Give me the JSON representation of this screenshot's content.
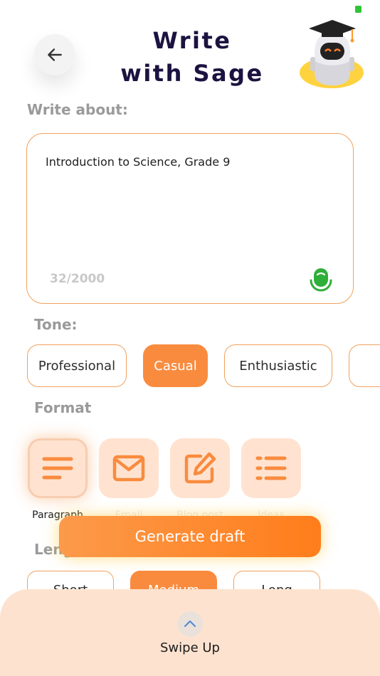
{
  "header": {
    "title_line1": "Write",
    "title_line2": "with Sage",
    "back_icon": "arrow-left-icon",
    "mascot": "robot-graduate-mascot"
  },
  "topic": {
    "label": "Write about:",
    "value": "Introduction to Science, Grade 9",
    "char_count": "32/2000",
    "mic_icon": "microphone-icon"
  },
  "tone": {
    "label": "Tone:",
    "options": [
      "Professional",
      "Casual",
      "Enthusiastic"
    ],
    "selected": "Casual"
  },
  "format": {
    "label": "Format",
    "options": [
      {
        "label": "Paragraph",
        "icon": "paragraph-icon"
      },
      {
        "label": "Email",
        "icon": "mail-icon"
      },
      {
        "label": "Blog post",
        "icon": "edit-icon"
      },
      {
        "label": "Ideas",
        "icon": "list-icon"
      }
    ],
    "selected": "Paragraph"
  },
  "length": {
    "label": "Length",
    "options": [
      "Short",
      "Medium",
      "Long"
    ],
    "selected": "Medium"
  },
  "generate_button": "Generate draft",
  "sheet": {
    "swipe_label": "Swipe Up",
    "swipe_icon": "chevron-up-icon"
  },
  "colors": {
    "accent": "#f98b3f",
    "accent_light": "#ffe3d0",
    "title": "#1c1340",
    "mic": "#2fae39",
    "sheet": "#fde3cf"
  }
}
